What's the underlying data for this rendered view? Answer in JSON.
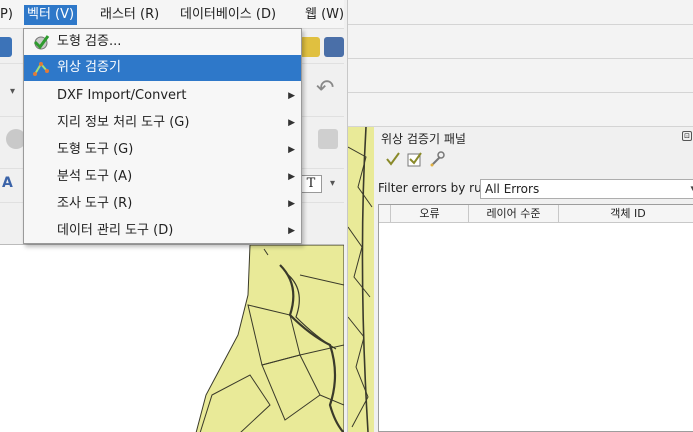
{
  "menubar": {
    "items": [
      {
        "label": "P)"
      },
      {
        "label": "벡터 (V)"
      },
      {
        "label": "래스터 (R)"
      },
      {
        "label": "데이터베이스 (D)"
      },
      {
        "label": "웹 (W)"
      }
    ]
  },
  "vector_menu": {
    "items": [
      {
        "label": "도형 검증...",
        "icon": "check-geometry-icon"
      },
      {
        "label": "위상 검증기",
        "icon": "topology-checker-icon"
      },
      {
        "label": "DXF Import/Convert",
        "submenu": true
      },
      {
        "label": "지리 정보 처리 도구 (G)",
        "submenu": true
      },
      {
        "label": "도형 도구 (G)",
        "submenu": true
      },
      {
        "label": "분석 도구 (A)",
        "submenu": true
      },
      {
        "label": "조사 도구 (R)",
        "submenu": true
      },
      {
        "label": "데이터 관리 도구 (D)",
        "submenu": true
      }
    ],
    "highlighted_index": 1,
    "submenu_arrow": "▶"
  },
  "topology_panel": {
    "title": "위상 검증기 패널",
    "float_glyph": "⊡",
    "tools": [
      "validate-all-icon",
      "validate-extent-icon",
      "configure-rules-icon"
    ],
    "filter_label": "Filter errors by rule",
    "filter_value": "All Errors",
    "columns": [
      "오류",
      "레이어 수준",
      "객체 ID"
    ]
  },
  "colors": {
    "accent": "#2e78c9",
    "map_fill": "#e9ea98",
    "map_stroke": "#3a3a2a"
  }
}
